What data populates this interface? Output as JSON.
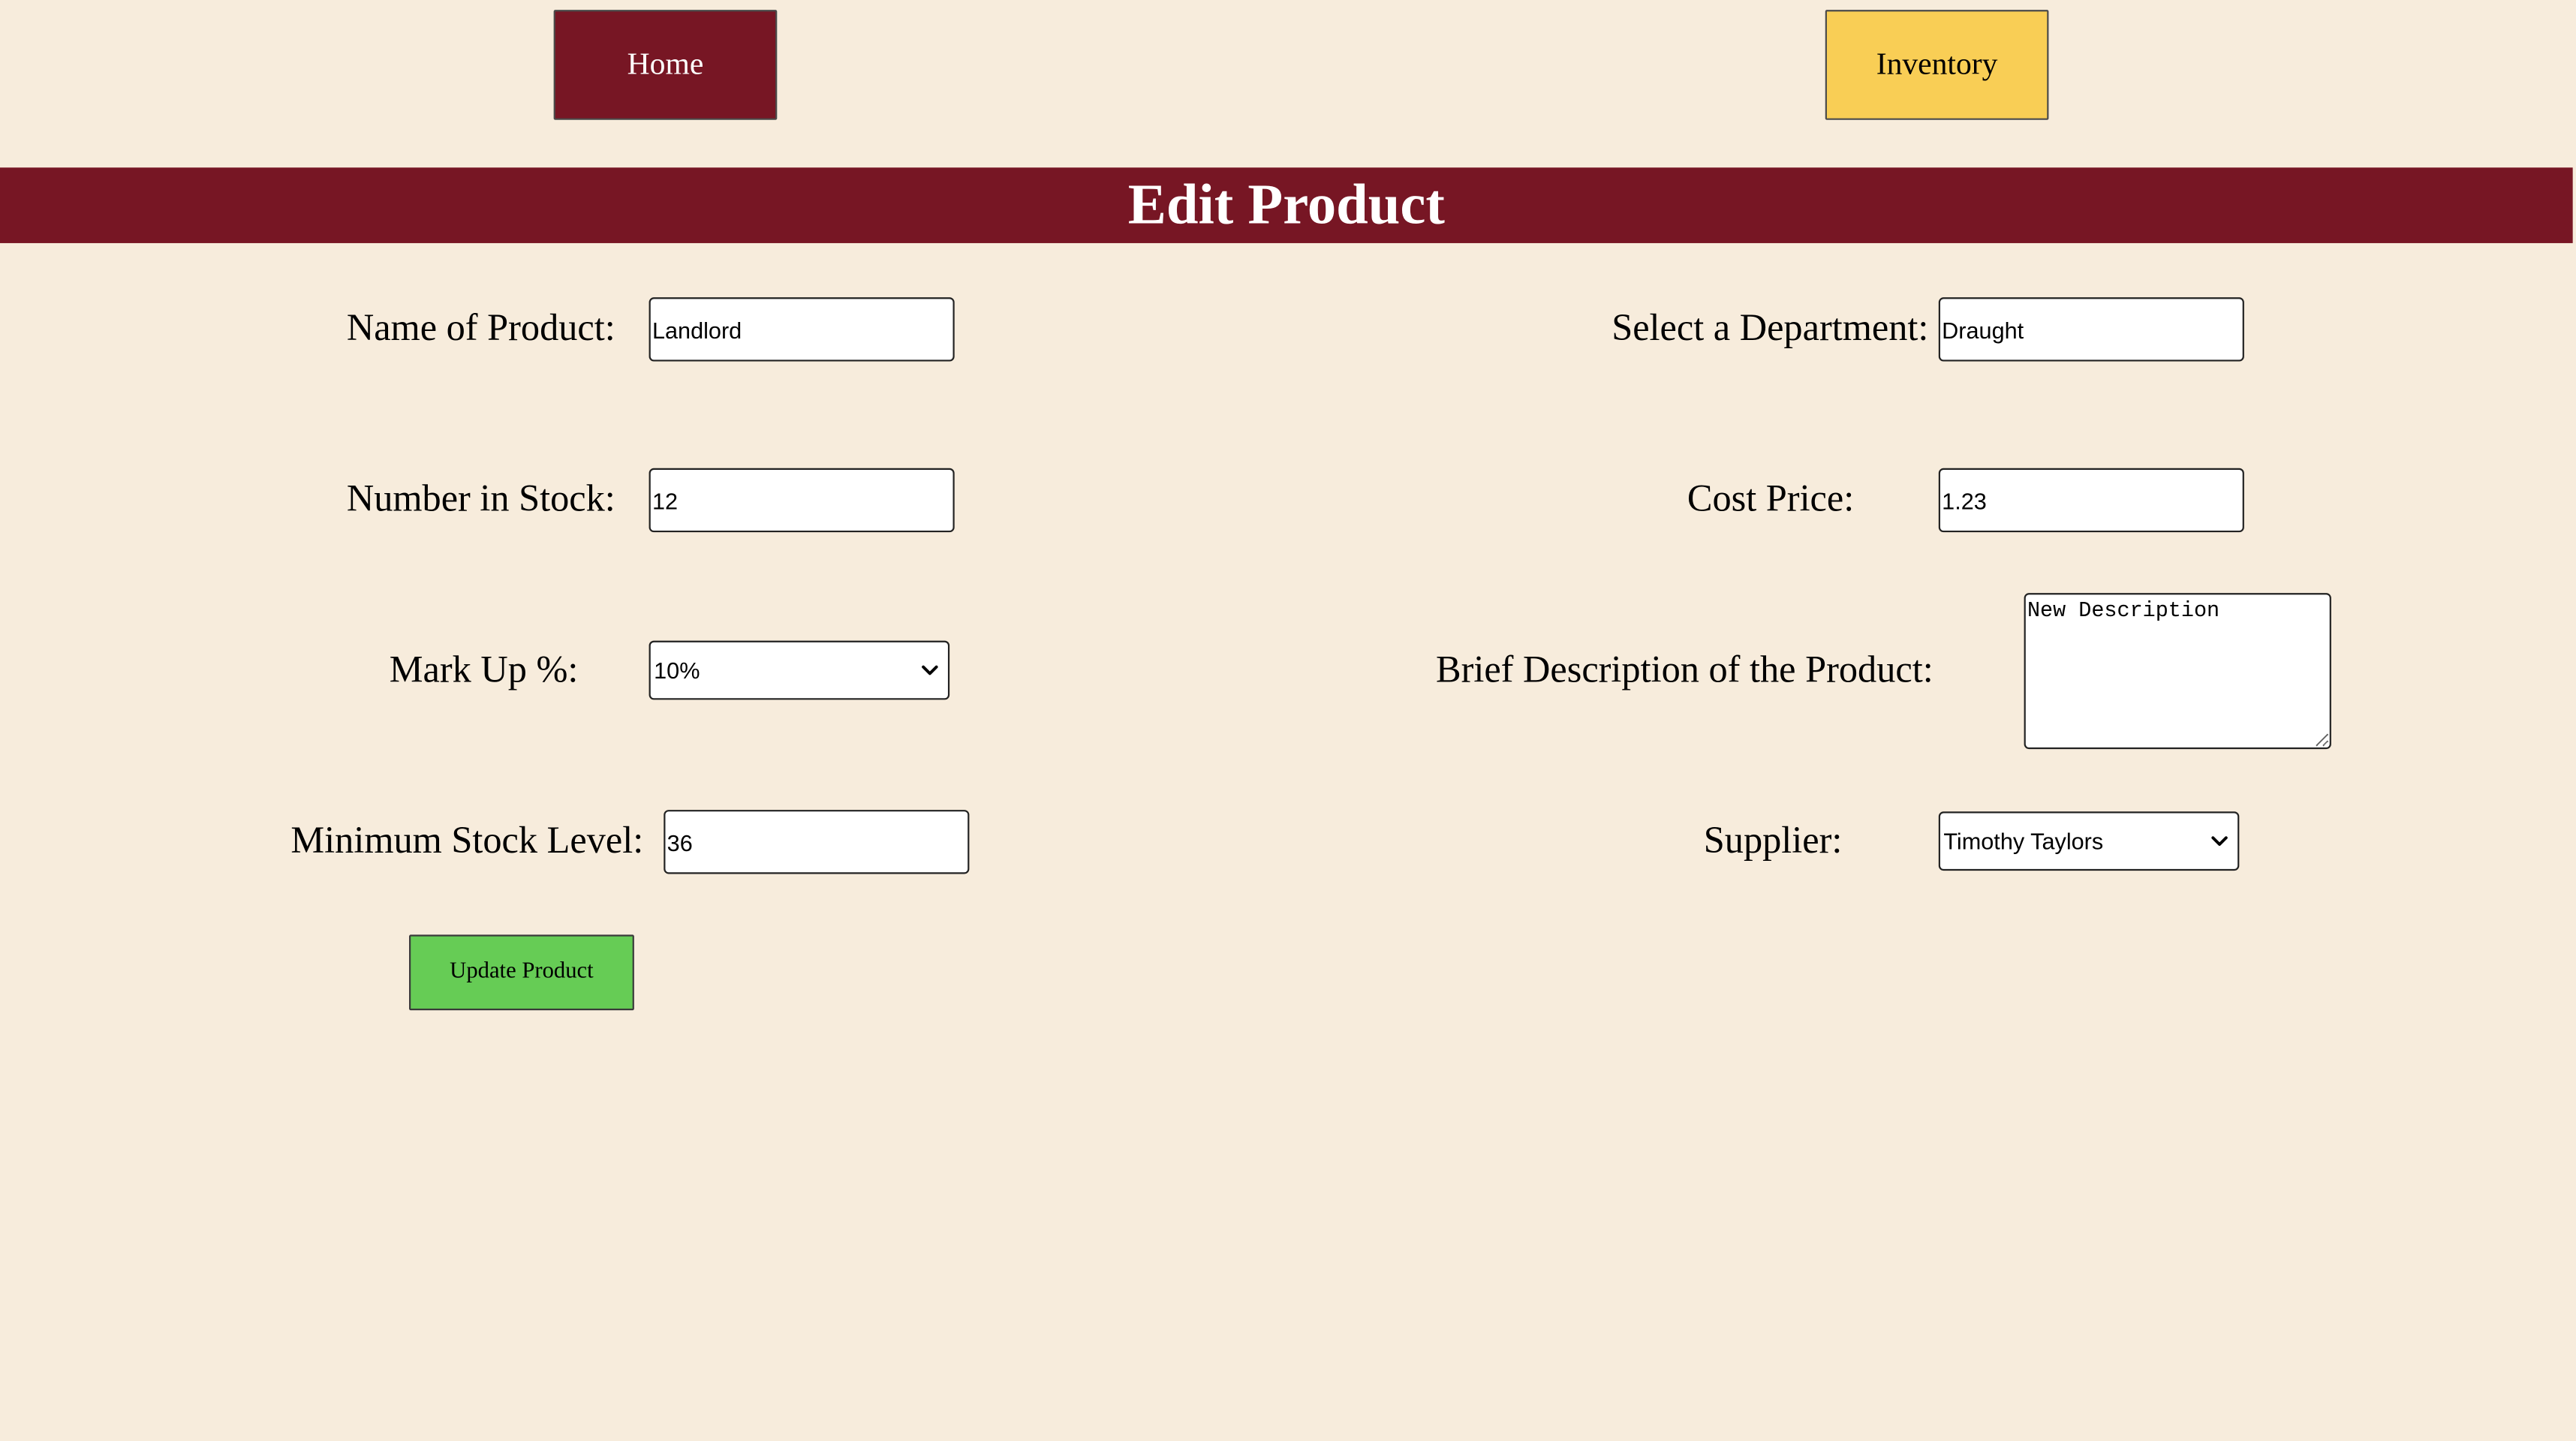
{
  "nav": {
    "home_label": "Home",
    "inventory_label": "Inventory"
  },
  "page": {
    "title": "Edit Product"
  },
  "form": {
    "name": {
      "label": "Name of Product:",
      "value": "Landlord"
    },
    "department": {
      "label": "Select a Department:",
      "value": "Draught"
    },
    "stock": {
      "label": "Number in Stock:",
      "value": "12"
    },
    "cost": {
      "label": "Cost Price:",
      "value": "1.23"
    },
    "markup": {
      "label": "Mark Up %:",
      "selected": "10%"
    },
    "description": {
      "label": "Brief Description of the Product:",
      "value": "New Description"
    },
    "min_stock": {
      "label": "Minimum Stock Level:",
      "value": "36"
    },
    "supplier": {
      "label": "Supplier:",
      "selected": "Timothy Taylors"
    },
    "submit_label": "Update Product"
  },
  "icons": {
    "dropdown": "chevron-down-icon"
  }
}
